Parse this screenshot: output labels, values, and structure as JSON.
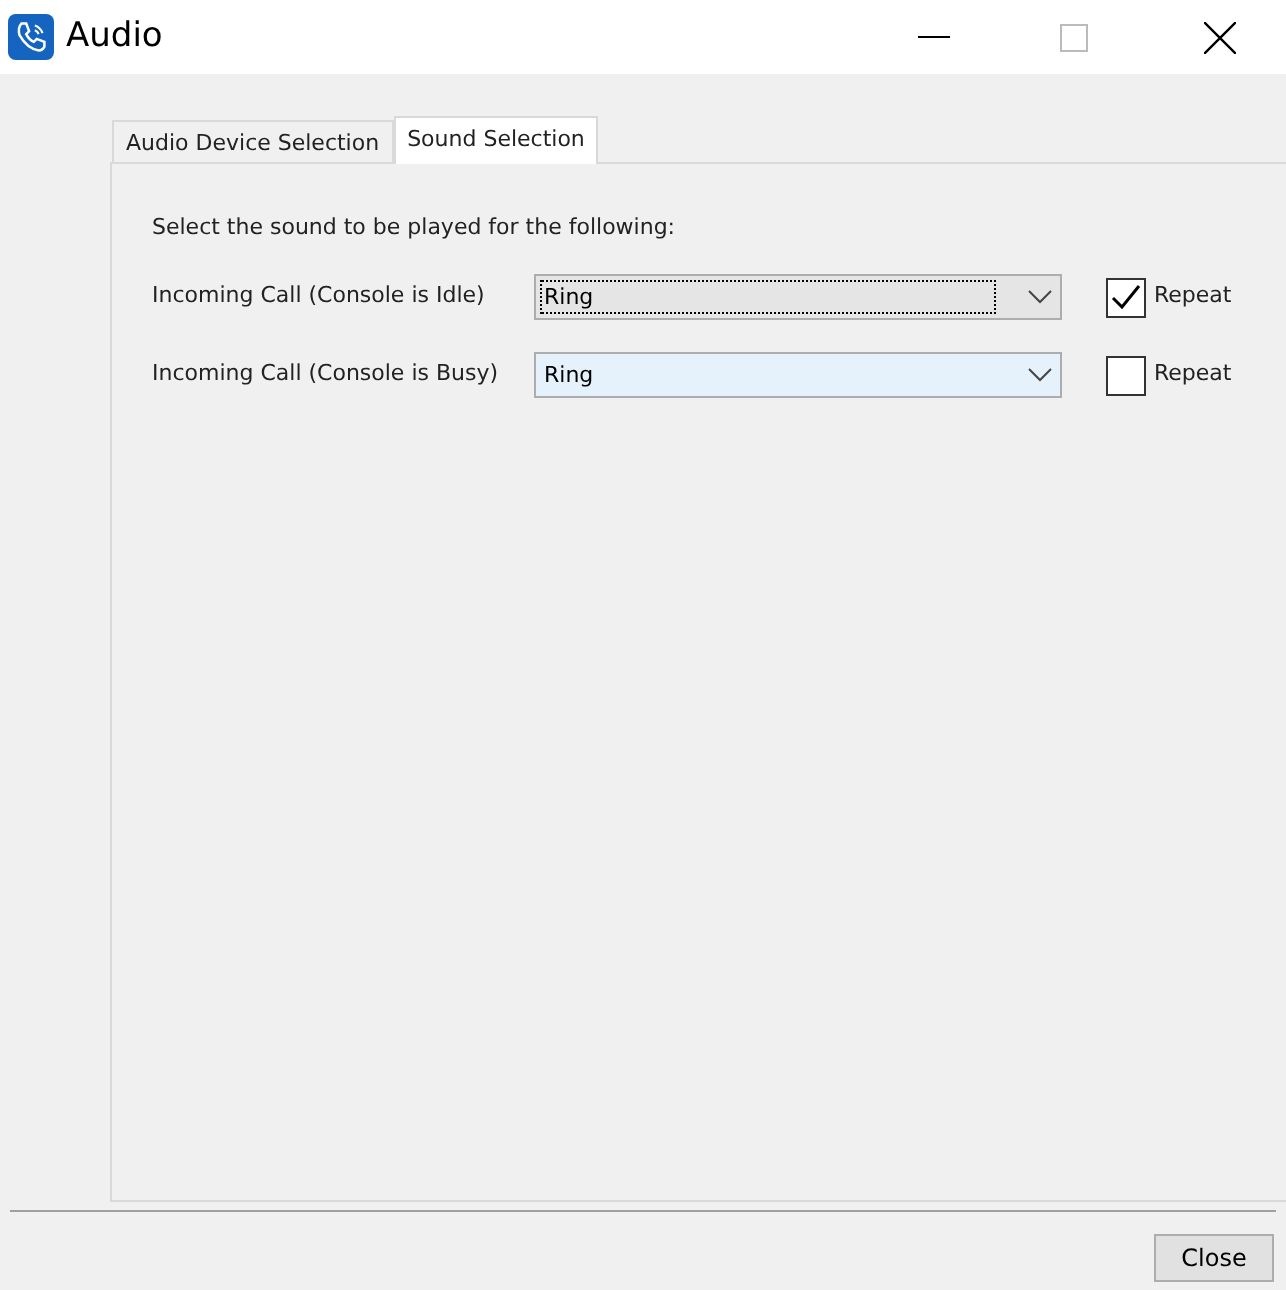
{
  "window": {
    "title": "Audio"
  },
  "tabs": [
    {
      "label": "Audio Device Selection",
      "selected": false
    },
    {
      "label": "Sound Selection",
      "selected": true
    }
  ],
  "instruction": "Select the sound to be played for the following:",
  "rows": [
    {
      "label": "Incoming Call (Console is Idle)",
      "value": "Ring",
      "focused": true,
      "repeat_label": "Repeat",
      "checked": true
    },
    {
      "label": "Incoming Call (Console is Busy)",
      "value": "Ring",
      "focused": false,
      "repeat_label": "Repeat",
      "checked": false
    }
  ],
  "buttons": [
    "Close"
  ]
}
